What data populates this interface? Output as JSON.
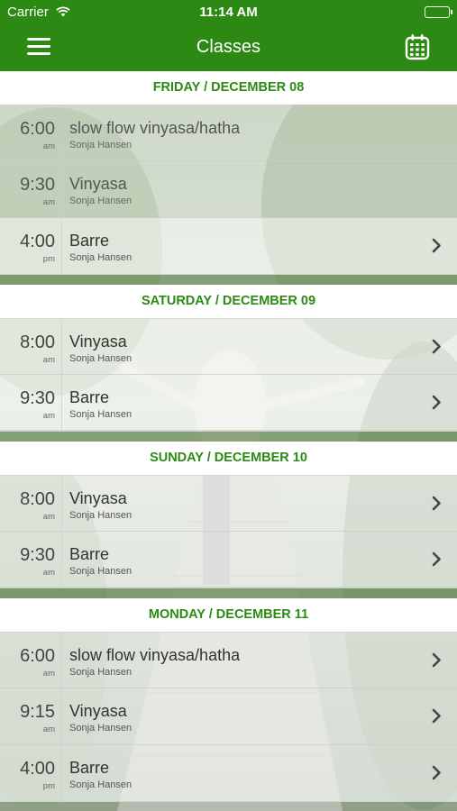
{
  "status_bar": {
    "carrier": "Carrier",
    "time": "11:14 AM"
  },
  "nav": {
    "title": "Classes"
  },
  "colors": {
    "accent": "#2c8a14"
  },
  "days": [
    {
      "label": "FRIDAY / DECEMBER 08",
      "classes": [
        {
          "time": "6:00",
          "ampm": "am",
          "name": "slow flow vinyasa/hatha",
          "instructor": "Sonja Hansen",
          "past": true
        },
        {
          "time": "9:30",
          "ampm": "am",
          "name": "Vinyasa",
          "instructor": "Sonja Hansen",
          "past": true
        },
        {
          "time": "4:00",
          "ampm": "pm",
          "name": "Barre",
          "instructor": "Sonja Hansen",
          "past": false
        }
      ]
    },
    {
      "label": "SATURDAY / DECEMBER 09",
      "classes": [
        {
          "time": "8:00",
          "ampm": "am",
          "name": "Vinyasa",
          "instructor": "Sonja Hansen",
          "past": false
        },
        {
          "time": "9:30",
          "ampm": "am",
          "name": "Barre",
          "instructor": "Sonja Hansen",
          "past": false
        }
      ]
    },
    {
      "label": "SUNDAY / DECEMBER 10",
      "classes": [
        {
          "time": "8:00",
          "ampm": "am",
          "name": "Vinyasa",
          "instructor": "Sonja Hansen",
          "past": false
        },
        {
          "time": "9:30",
          "ampm": "am",
          "name": "Barre",
          "instructor": "Sonja Hansen",
          "past": false
        }
      ]
    },
    {
      "label": "MONDAY / DECEMBER 11",
      "classes": [
        {
          "time": "6:00",
          "ampm": "am",
          "name": "slow flow vinyasa/hatha",
          "instructor": "Sonja Hansen",
          "past": false
        },
        {
          "time": "9:15",
          "ampm": "am",
          "name": "Vinyasa",
          "instructor": "Sonja Hansen",
          "past": false
        },
        {
          "time": "4:00",
          "ampm": "pm",
          "name": "Barre",
          "instructor": "Sonja Hansen",
          "past": false
        }
      ]
    }
  ]
}
